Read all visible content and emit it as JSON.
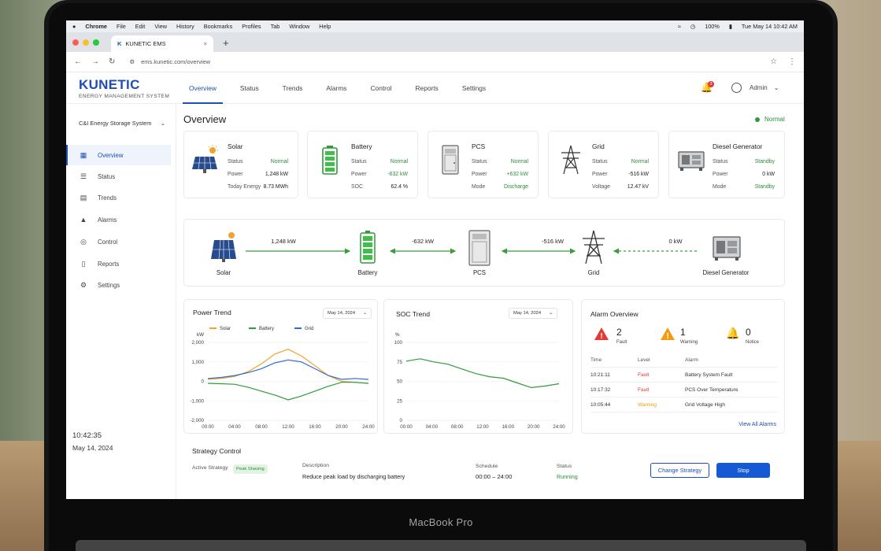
{
  "device": {
    "label": "MacBook Pro"
  },
  "menubar": {
    "apple": "",
    "items": [
      "Chrome",
      "File",
      "Edit",
      "View",
      "History",
      "Bookmarks",
      "Profiles",
      "Tab",
      "Window",
      "Help"
    ],
    "battery": "100%",
    "datetime": "Tue May 14  10:42 AM"
  },
  "browser": {
    "tab_title": "KUNETIC EMS",
    "tab_close": "×",
    "new_tab": "+",
    "url": "ems.kunetic.com/overview"
  },
  "app": {
    "logo": "KUNETIC",
    "logo_sub": "ENERGY MANAGEMENT SYSTEM",
    "nav": [
      "Overview",
      "Status",
      "Trends",
      "Alarms",
      "Control",
      "Reports",
      "Settings"
    ],
    "notification_count": "3",
    "user": "Admin"
  },
  "sidebar": {
    "system": "C&I Energy Storage System",
    "items": [
      "Overview",
      "Status",
      "Trends",
      "Alarms",
      "Control",
      "Reports",
      "Settings"
    ],
    "time": "10:42:35",
    "date": "May 14, 2024"
  },
  "page": {
    "title": "Overview",
    "status": "Normal"
  },
  "cards": [
    {
      "name": "Solar",
      "rows": [
        [
          "Status",
          "Normal"
        ],
        [
          "Power",
          "1,248 kW"
        ],
        [
          "Today Energy",
          "8.73 MWh"
        ]
      ]
    },
    {
      "name": "Battery",
      "rows": [
        [
          "Status",
          "Normal"
        ],
        [
          "Power",
          "-632 kW"
        ],
        [
          "SOC",
          "62.4 %"
        ]
      ]
    },
    {
      "name": "PCS",
      "rows": [
        [
          "Status",
          "Normal"
        ],
        [
          "Power",
          "+632 kW"
        ],
        [
          "Mode",
          "Discharge"
        ]
      ]
    },
    {
      "name": "Grid",
      "rows": [
        [
          "Status",
          "Normal"
        ],
        [
          "Power",
          "-516 kW"
        ],
        [
          "Voltage",
          "12.47 kV"
        ]
      ]
    },
    {
      "name": "Diesel Generator",
      "rows": [
        [
          "Status",
          "Standby"
        ],
        [
          "Power",
          "0 kW"
        ],
        [
          "Mode",
          "Standby"
        ]
      ]
    }
  ],
  "flow": {
    "nodes": [
      "Solar",
      "Battery",
      "PCS",
      "Grid",
      "Diesel Generator"
    ],
    "values": [
      "1,248 kW",
      "-632 kW",
      "-516 kW",
      "0 kW"
    ]
  },
  "power_trend": {
    "title": "Power Trend",
    "date": "May 14, 2024",
    "unit": "kW"
  },
  "soc_trend": {
    "title": "SOC Trend",
    "date": "May 14, 2024",
    "unit": "%"
  },
  "alarms": {
    "title": "Alarm Overview",
    "summary": [
      [
        "2",
        "Fault"
      ],
      [
        "1",
        "Warning"
      ],
      [
        "0",
        "Notice"
      ]
    ],
    "headers": [
      "Time",
      "Level",
      "Alarm"
    ],
    "rows": [
      [
        "10:21:11",
        "Fault",
        "Battery System Fault"
      ],
      [
        "10:17:32",
        "Fault",
        "PCS Over Temperature"
      ],
      [
        "10:05:44",
        "Warning",
        "Grid Voltage High"
      ]
    ],
    "view_all": "View All Alarms"
  },
  "strategy": {
    "title": "Strategy Control",
    "active_label": "Active Strategy",
    "active_value": "Peak Shaving",
    "desc_label": "Description",
    "desc_value": "Reduce peak load by discharging battery",
    "sched_label": "Schedule",
    "sched_value": "00:00 – 24:00",
    "status_label": "Status",
    "status_value": "Running",
    "change_btn": "Change Strategy",
    "stop_btn": "Stop"
  },
  "colors": {
    "accent": "#1d4db5",
    "solar": "#f2a32b",
    "battery": "#2e9c3b",
    "grid": "#2f6bd1",
    "fault": "#e53935",
    "warning": "#f39c12"
  },
  "chart_data": [
    {
      "type": "line",
      "ylabel": "kW",
      "x": [
        "00:00",
        "04:00",
        "08:00",
        "12:00",
        "16:00",
        "20:00",
        "24:00"
      ],
      "ylim": [
        -2000,
        2000
      ],
      "yticks": [
        2000,
        1000,
        0,
        -1000,
        -2000
      ],
      "ytick_labels": [
        "2,000",
        "1,000",
        "0",
        "-1,000",
        "-2,000"
      ],
      "legend": "top-left",
      "series": [
        {
          "name": "Solar",
          "color": "#f2a32b",
          "values": [
            100,
            150,
            250,
            500,
            900,
            1400,
            1650,
            1300,
            800,
            300,
            0,
            -50,
            -100
          ]
        },
        {
          "name": "Battery",
          "color": "#2e9c3b",
          "values": [
            -100,
            -120,
            -150,
            -300,
            -500,
            -700,
            -950,
            -750,
            -500,
            -250,
            -50,
            -50,
            -100
          ]
        },
        {
          "name": "Grid",
          "color": "#2f6bd1",
          "values": [
            150,
            200,
            300,
            450,
            650,
            950,
            1100,
            1000,
            650,
            300,
            100,
            150,
            100
          ]
        }
      ]
    },
    {
      "type": "line",
      "ylabel": "%",
      "x": [
        "00:00",
        "04:00",
        "08:00",
        "12:00",
        "16:00",
        "20:00",
        "24:00"
      ],
      "ylim": [
        0,
        100
      ],
      "yticks": [
        100,
        75,
        50,
        25,
        0
      ],
      "series": [
        {
          "name": "SOC",
          "color": "#2e9c3b",
          "values": [
            76,
            79,
            75,
            72,
            66,
            60,
            56,
            54,
            48,
            42,
            44,
            47
          ]
        }
      ]
    }
  ]
}
